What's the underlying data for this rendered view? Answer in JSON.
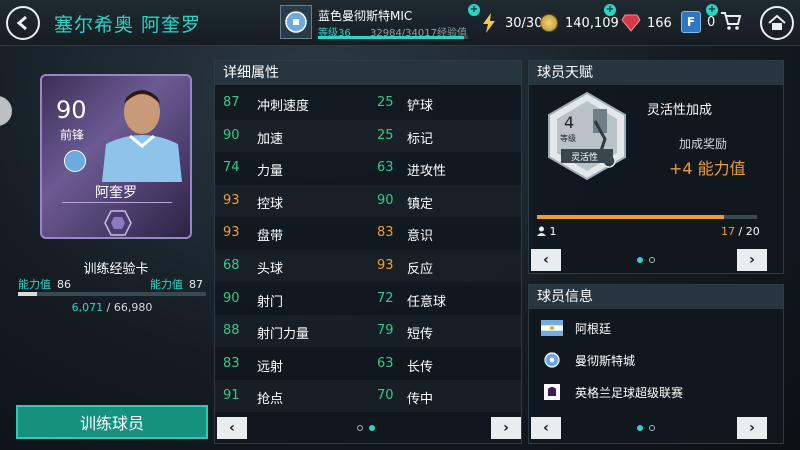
{
  "header": {
    "title": "塞尔希奥 阿奎罗",
    "club": {
      "name": "蓝色曼彻斯特MIC",
      "level": "等级36",
      "xp": "32984/34017经验值",
      "xp_fraction": 0.97
    },
    "resources": {
      "energy": "30/30",
      "coins": "140,109",
      "gems": "166",
      "fifa_points": "0"
    }
  },
  "card": {
    "rating": "90",
    "position": "前锋",
    "name": "阿奎罗",
    "training_label": "训练经验卡",
    "ovr_current_label": "能力值",
    "ovr_current": "86",
    "ovr_next_label": "能力值",
    "ovr_next": "87",
    "ovr_fraction": 0.1,
    "xp_current": "6,071",
    "xp_sep": " / ",
    "xp_total": "66,980"
  },
  "train_button": "训练球员",
  "attributes": {
    "title": "详细属性",
    "left": [
      {
        "value": "87",
        "name": "冲刺速度",
        "color": "green"
      },
      {
        "value": "90",
        "name": "加速",
        "color": "green"
      },
      {
        "value": "74",
        "name": "力量",
        "color": "green"
      },
      {
        "value": "93",
        "name": "控球",
        "color": "orange"
      },
      {
        "value": "93",
        "name": "盘带",
        "color": "orange"
      },
      {
        "value": "68",
        "name": "头球",
        "color": "green"
      },
      {
        "value": "90",
        "name": "射门",
        "color": "green"
      },
      {
        "value": "88",
        "name": "射门力量",
        "color": "green"
      },
      {
        "value": "83",
        "name": "远射",
        "color": "green"
      },
      {
        "value": "91",
        "name": "抢点",
        "color": "green"
      }
    ],
    "right": [
      {
        "value": "25",
        "name": "铲球",
        "color": "green"
      },
      {
        "value": "25",
        "name": "标记",
        "color": "green"
      },
      {
        "value": "63",
        "name": "进攻性",
        "color": "green"
      },
      {
        "value": "90",
        "name": "镇定",
        "color": "green"
      },
      {
        "value": "83",
        "name": "意识",
        "color": "orange"
      },
      {
        "value": "93",
        "name": "反应",
        "color": "orange"
      },
      {
        "value": "72",
        "name": "任意球",
        "color": "green"
      },
      {
        "value": "79",
        "name": "短传",
        "color": "green"
      },
      {
        "value": "63",
        "name": "长传",
        "color": "green"
      },
      {
        "value": "70",
        "name": "传中",
        "color": "green"
      }
    ]
  },
  "talent": {
    "title": "球员天赋",
    "level_num": "4",
    "level_label": "等级",
    "badge_label": "灵活性",
    "name": "灵活性加成",
    "bonus_label": "加成奖励",
    "bonus_value": "+4 能力值",
    "progress_fraction": 0.85,
    "level": "1",
    "progress_current": "17",
    "progress_total": "20"
  },
  "info": {
    "title": "球员信息",
    "nation": "阿根廷",
    "club": "曼彻斯特城",
    "league": "英格兰足球超级联赛"
  },
  "colors": {
    "accent": "#28d6c7",
    "orange": "#f09a3a",
    "green": "#34c98a"
  }
}
